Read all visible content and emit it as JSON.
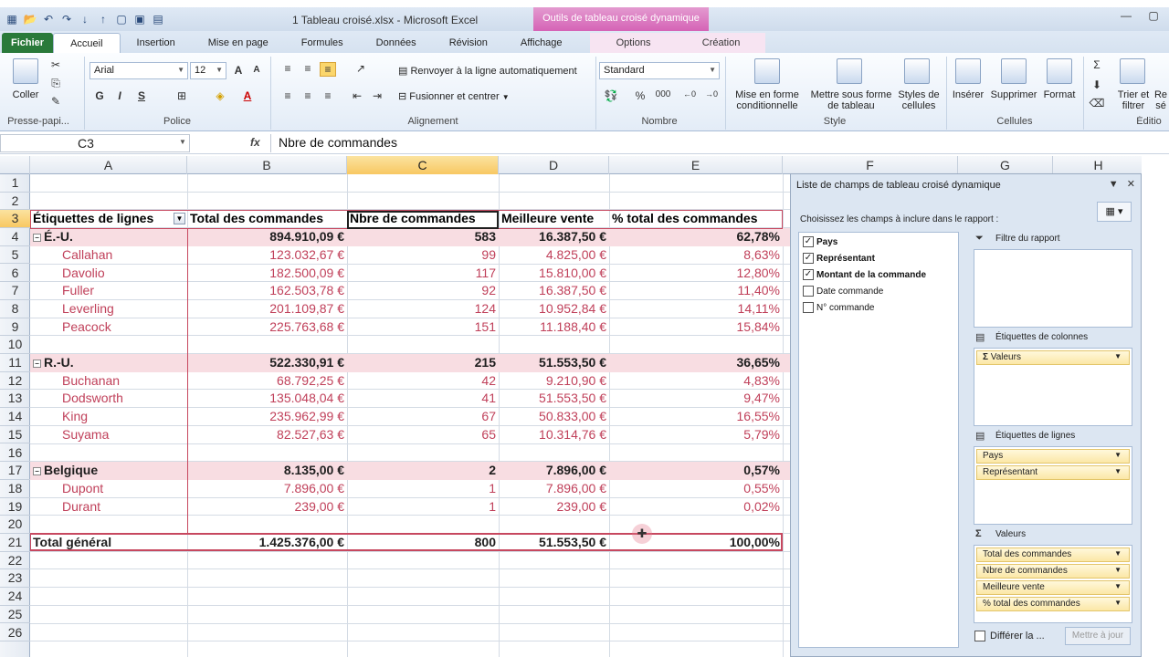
{
  "window": {
    "title": "1 Tableau croisé.xlsx  -  Microsoft Excel",
    "context_tool": "Outils de tableau croisé dynamique"
  },
  "tabs": [
    "Accueil",
    "Insertion",
    "Mise en page",
    "Formules",
    "Données",
    "Révision",
    "Affichage"
  ],
  "tab_file": "Fichier",
  "context_tabs": [
    "Options",
    "Création"
  ],
  "ribbon": {
    "clipboard": {
      "paste": "Coller",
      "group": "Presse-papi..."
    },
    "font": {
      "name": "Arial",
      "size": "12",
      "bold": "G",
      "italic": "I",
      "underline": "S",
      "group": "Police"
    },
    "alignment": {
      "wrap": "Renvoyer à la ligne automatiquement",
      "merge": "Fusionner et centrer",
      "group": "Alignement"
    },
    "number": {
      "format": "Standard",
      "percent": "%",
      "thousands": "000",
      "group": "Nombre"
    },
    "style": {
      "cond": "Mise en forme conditionnelle",
      "table": "Mettre sous forme de tableau",
      "cell": "Styles de cellules",
      "group": "Style"
    },
    "cells": {
      "insert": "Insérer",
      "delete": "Supprimer",
      "format": "Format",
      "group": "Cellules"
    },
    "edit": {
      "sort": "Trier et filtrer",
      "find": "Re sé",
      "group": "Éditio"
    }
  },
  "formula_bar": {
    "name_box": "C3",
    "fx": "fx",
    "formula": "Nbre de commandes"
  },
  "columns": [
    "A",
    "B",
    "C",
    "D",
    "E",
    "F",
    "G",
    "H"
  ],
  "rows": [
    "1",
    "2",
    "3",
    "4",
    "5",
    "6",
    "7",
    "8",
    "9",
    "10",
    "11",
    "12",
    "13",
    "14",
    "15",
    "16",
    "17",
    "18",
    "19",
    "20",
    "21",
    "22",
    "23",
    "24",
    "25",
    "26"
  ],
  "pivot": {
    "headers": [
      "Étiquettes de lignes",
      "Total des commandes",
      "Nbre de commandes",
      "Meilleure vente",
      "% total des commandes"
    ],
    "rows": [
      {
        "row": "4",
        "type": "group",
        "label": "É.-U.",
        "total": "894.910,09 €",
        "count": "583",
        "best": "16.387,50 €",
        "pct": "62,78%"
      },
      {
        "row": "5",
        "type": "item",
        "label": "Callahan",
        "total": "123.032,67 €",
        "count": "99",
        "best": "4.825,00 €",
        "pct": "8,63%"
      },
      {
        "row": "6",
        "type": "item",
        "label": "Davolio",
        "total": "182.500,09 €",
        "count": "117",
        "best": "15.810,00 €",
        "pct": "12,80%"
      },
      {
        "row": "7",
        "type": "item",
        "label": "Fuller",
        "total": "162.503,78 €",
        "count": "92",
        "best": "16.387,50 €",
        "pct": "11,40%"
      },
      {
        "row": "8",
        "type": "item",
        "label": "Leverling",
        "total": "201.109,87 €",
        "count": "124",
        "best": "10.952,84 €",
        "pct": "14,11%"
      },
      {
        "row": "9",
        "type": "item",
        "label": "Peacock",
        "total": "225.763,68 €",
        "count": "151",
        "best": "11.188,40 €",
        "pct": "15,84%"
      },
      {
        "row": "10",
        "type": "blank"
      },
      {
        "row": "11",
        "type": "group",
        "label": "R.-U.",
        "total": "522.330,91 €",
        "count": "215",
        "best": "51.553,50 €",
        "pct": "36,65%"
      },
      {
        "row": "12",
        "type": "item",
        "label": "Buchanan",
        "total": "68.792,25 €",
        "count": "42",
        "best": "9.210,90 €",
        "pct": "4,83%"
      },
      {
        "row": "13",
        "type": "item",
        "label": "Dodsworth",
        "total": "135.048,04 €",
        "count": "41",
        "best": "51.553,50 €",
        "pct": "9,47%"
      },
      {
        "row": "14",
        "type": "item",
        "label": "King",
        "total": "235.962,99 €",
        "count": "67",
        "best": "50.833,00 €",
        "pct": "16,55%"
      },
      {
        "row": "15",
        "type": "item",
        "label": "Suyama",
        "total": "82.527,63 €",
        "count": "65",
        "best": "10.314,76 €",
        "pct": "5,79%"
      },
      {
        "row": "16",
        "type": "blank"
      },
      {
        "row": "17",
        "type": "group",
        "label": "Belgique",
        "total": "8.135,00 €",
        "count": "2",
        "best": "7.896,00 €",
        "pct": "0,57%"
      },
      {
        "row": "18",
        "type": "item",
        "label": "Dupont",
        "total": "7.896,00 €",
        "count": "1",
        "best": "7.896,00 €",
        "pct": "0,55%"
      },
      {
        "row": "19",
        "type": "item",
        "label": "Durant",
        "total": "239,00 €",
        "count": "1",
        "best": "239,00 €",
        "pct": "0,02%"
      },
      {
        "row": "20",
        "type": "blank"
      },
      {
        "row": "21",
        "type": "total",
        "label": "Total général",
        "total": "1.425.376,00 €",
        "count": "800",
        "best": "51.553,50 €",
        "pct": "100,00%"
      }
    ]
  },
  "field_pane": {
    "title": "Liste de champs de tableau croisé dynamique",
    "instruction": "Choisissez les champs à inclure dans le rapport :",
    "fields": [
      {
        "name": "Pays",
        "checked": true
      },
      {
        "name": "Représentant",
        "checked": true
      },
      {
        "name": "Montant de la commande",
        "checked": true
      },
      {
        "name": "Date commande",
        "checked": false
      },
      {
        "name": "N° commande",
        "checked": false
      }
    ],
    "zones": {
      "filter": "Filtre du rapport",
      "columns": "Étiquettes de colonnes",
      "rows": "Étiquettes de lignes",
      "values": "Valeurs"
    },
    "column_items": [
      "Valeurs"
    ],
    "row_items": [
      "Pays",
      "Représentant"
    ],
    "value_items": [
      "Total des commandes",
      "Nbre de commandes",
      "Meilleure vente",
      "% total des commandes"
    ],
    "defer": "Différer la ...",
    "update": "Mettre à jour"
  }
}
